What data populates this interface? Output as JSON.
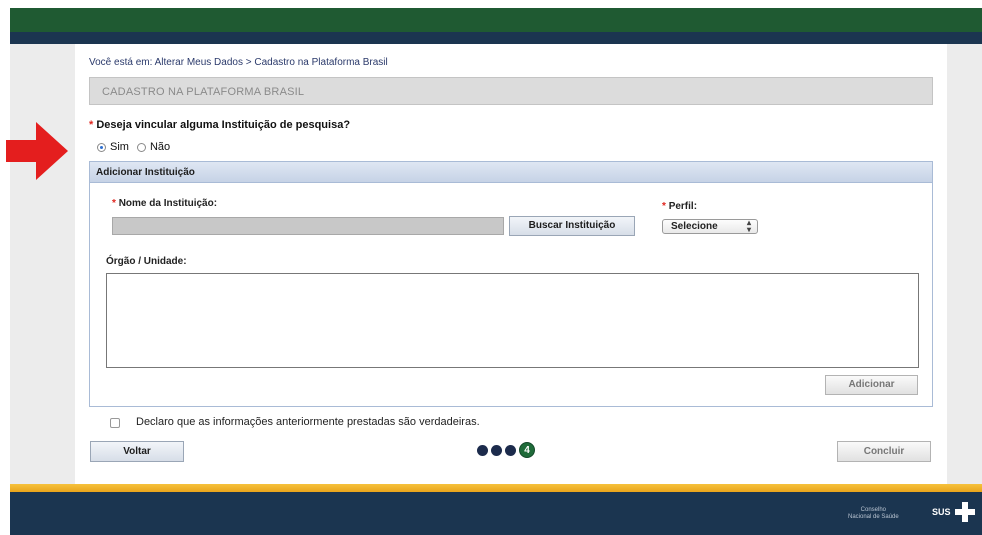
{
  "breadcrumb": "Você está em: Alterar Meus Dados > Cadastro na Plataforma Brasil",
  "section_title": "CADASTRO NA PLATAFORMA BRASIL",
  "required_marker": "*",
  "question": "Deseja vincular alguma Instituição de pesquisa?",
  "radio": {
    "sim": "Sim",
    "nao": "Não",
    "selected": "Sim"
  },
  "panel": {
    "title": "Adicionar Instituição",
    "institution_label": "Nome da Instituição:",
    "institution_value": "",
    "search_button": "Buscar Instituição",
    "profile_label": "Perfil:",
    "profile_value": "Selecione",
    "unit_label": "Órgão / Unidade:",
    "unit_value": "",
    "add_button": "Adicionar"
  },
  "declaration": "Declaro que as informações anteriormente prestadas são verdadeiras.",
  "declaration_checked": false,
  "back_button": "Voltar",
  "finish_button": "Concluir",
  "steps": {
    "current": "4",
    "total": 4
  },
  "footer": {
    "council_line1": "Conselho",
    "council_line2": "Nacional de Saúde",
    "sus": "SUS"
  },
  "colors": {
    "top_green": "#1f5a32",
    "navy": "#1b3550",
    "gold": "#f6c23c",
    "arrow_red": "#e41e1e",
    "radio_accent": "#2f6fd0"
  },
  "icons": {
    "arrow": "red-right-arrow-icon",
    "cross": "sus-cross-icon"
  }
}
